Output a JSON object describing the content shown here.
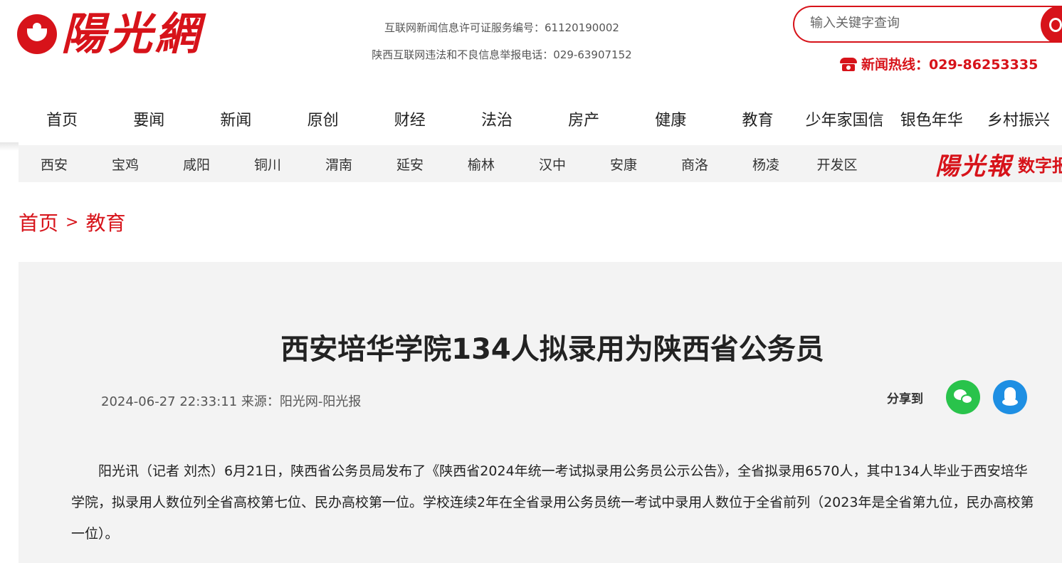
{
  "header": {
    "logo_text": "陽光網",
    "license_line1": "互联网新闻信息许可证服务编号：61120190002",
    "license_line2": "陕西互联网违法和不良信息举报电话：029-63907152",
    "search_placeholder": "输入关键字查询",
    "hotline": "新闻热线：029-86253335"
  },
  "main_nav": [
    "首页",
    "要闻",
    "新闻",
    "原创",
    "财经",
    "法治",
    "房产",
    "健康",
    "教育",
    "少年家国信",
    "银色年华",
    "乡村振兴"
  ],
  "sub_nav": [
    "西安",
    "宝鸡",
    "咸阳",
    "铜川",
    "渭南",
    "延安",
    "榆林",
    "汉中",
    "安康",
    "商洛",
    "杨凌",
    "开发区"
  ],
  "paper_brand": {
    "logo": "陽光報",
    "suffix": "数字报"
  },
  "breadcrumb": {
    "home": "首页",
    "separator": ">",
    "current": "教育"
  },
  "article": {
    "title": "西安培华学院134人拟录用为陕西省公务员",
    "meta": "2024-06-27 22:33:11 来源：阳光网-阳光报",
    "share_label": "分享到",
    "body": "阳光讯（记者 刘杰）6月21日，陕西省公务员局发布了《陕西省2024年统一考试拟录用公务员公示公告》，全省拟录用6570人，其中134人毕业于西安培华学院，拟录用人数位列全省高校第七位、民办高校第一位。学校连续2年在全省录用公务员统一考试中录用人数位于全省前列（2023年是全省第九位，民办高校第一位）。"
  },
  "colors": {
    "brand_red": "#d7131a",
    "panel_gray": "#f3f3f3",
    "wechat_green": "#29c34b",
    "qq_blue": "#1e8fe3"
  },
  "icons": [
    "logo-mark-icon",
    "search-icon",
    "phone-icon",
    "wechat-icon",
    "qq-icon"
  ]
}
